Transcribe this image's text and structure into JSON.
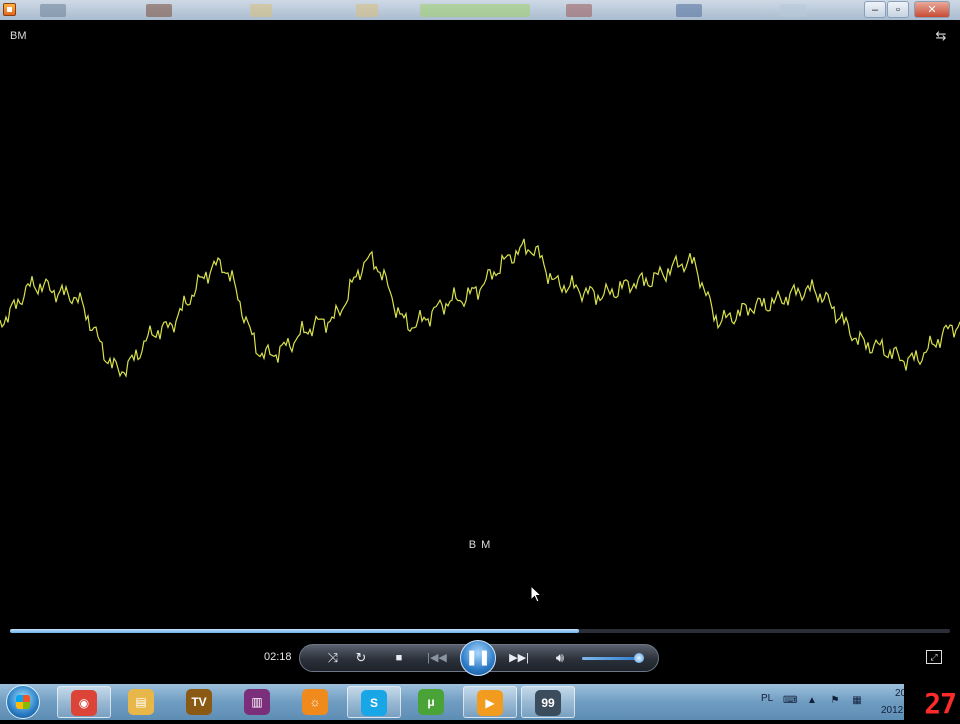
{
  "window": {
    "minimize_glyph": "–",
    "maximize_glyph": "▫",
    "close_glyph": "✕"
  },
  "video": {
    "corner_title": "BM",
    "center_title": "B M",
    "waveform_color": "#d9e24a"
  },
  "player": {
    "elapsed": "02:18",
    "progress_fraction": 0.605,
    "volume_fraction": 0.93,
    "icons": [
      "shuffle-icon",
      "repeat-icon",
      "stop-icon",
      "previous-icon",
      "pause-icon",
      "next-icon",
      "volume-icon",
      "fullscreen-icon",
      "switch-to-library-icon"
    ],
    "accent_color": "#4a9be6"
  },
  "taskbar": {
    "apps": [
      {
        "name": "chrome",
        "open": true,
        "color": "#db4437",
        "glyph": "◉"
      },
      {
        "name": "explorer",
        "open": false,
        "color": "#e8b74a",
        "glyph": "▤"
      },
      {
        "name": "tv",
        "open": false,
        "color": "#8a5a14",
        "glyph": "TV"
      },
      {
        "name": "winrar",
        "open": false,
        "color": "#7b2f7a",
        "glyph": "▥"
      },
      {
        "name": "sun-app",
        "open": false,
        "color": "#f08a1c",
        "glyph": "☼"
      },
      {
        "name": "skype",
        "open": true,
        "color": "#19a6e6",
        "glyph": "S"
      },
      {
        "name": "utorrent",
        "open": false,
        "color": "#4aa336",
        "glyph": "μ"
      },
      {
        "name": "media-player",
        "open": true,
        "color": "#f29c1f",
        "glyph": "▶"
      },
      {
        "name": "computer-99",
        "open": true,
        "color": "#3b4d5c",
        "glyph": "99"
      }
    ],
    "language": "PL",
    "year_partial": "2012",
    "badge": "27",
    "badge_color": "#ff2a2a"
  }
}
